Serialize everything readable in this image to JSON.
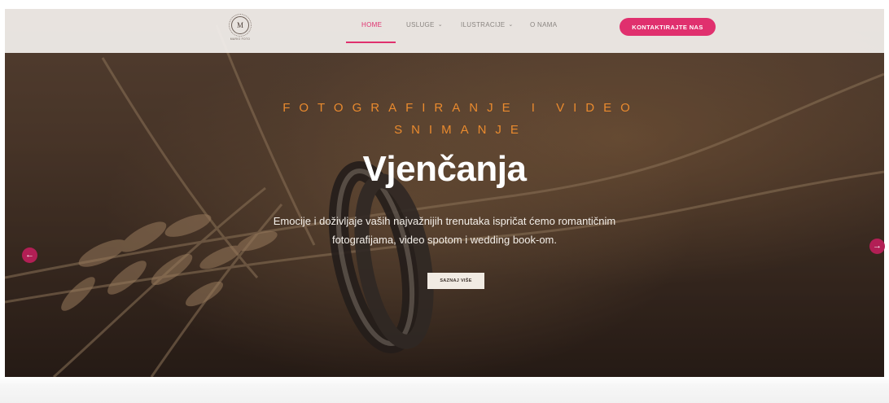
{
  "logo": {
    "text": "MARIO FOTO",
    "mark": "M"
  },
  "nav": {
    "items": [
      {
        "label": "HOME",
        "active": true
      },
      {
        "label": "USLUGE",
        "dropdown": true
      },
      {
        "label": "ILUSTRACIJE",
        "dropdown": true
      },
      {
        "label": "O NAMA"
      }
    ],
    "cta_label": "KONTAKTIRAJTE NAS"
  },
  "hero": {
    "kicker_line1": "FOTOGRAFIRANJE I VIDEO",
    "kicker_line2": "SNIMANJE",
    "title": "Vjenčanja",
    "subtitle_line1": "Emocije i doživljaje vaših najvažnijih trenutaka ispričat ćemo romantičnim",
    "subtitle_line2": "fotografijama, video spotom i wedding book-om.",
    "button_label": "SAZNAJ VIŠE",
    "prev_arrow": "←",
    "next_arrow": "→"
  },
  "icons": {
    "chevron": "⌄",
    "prev": "arrow-left-icon",
    "next": "arrow-right-icon"
  },
  "colors": {
    "accent": "#e0306e",
    "arrow_bg": "#b21f55",
    "kicker": "#e98a2e",
    "navbar_bg": "#f3f0ed"
  }
}
